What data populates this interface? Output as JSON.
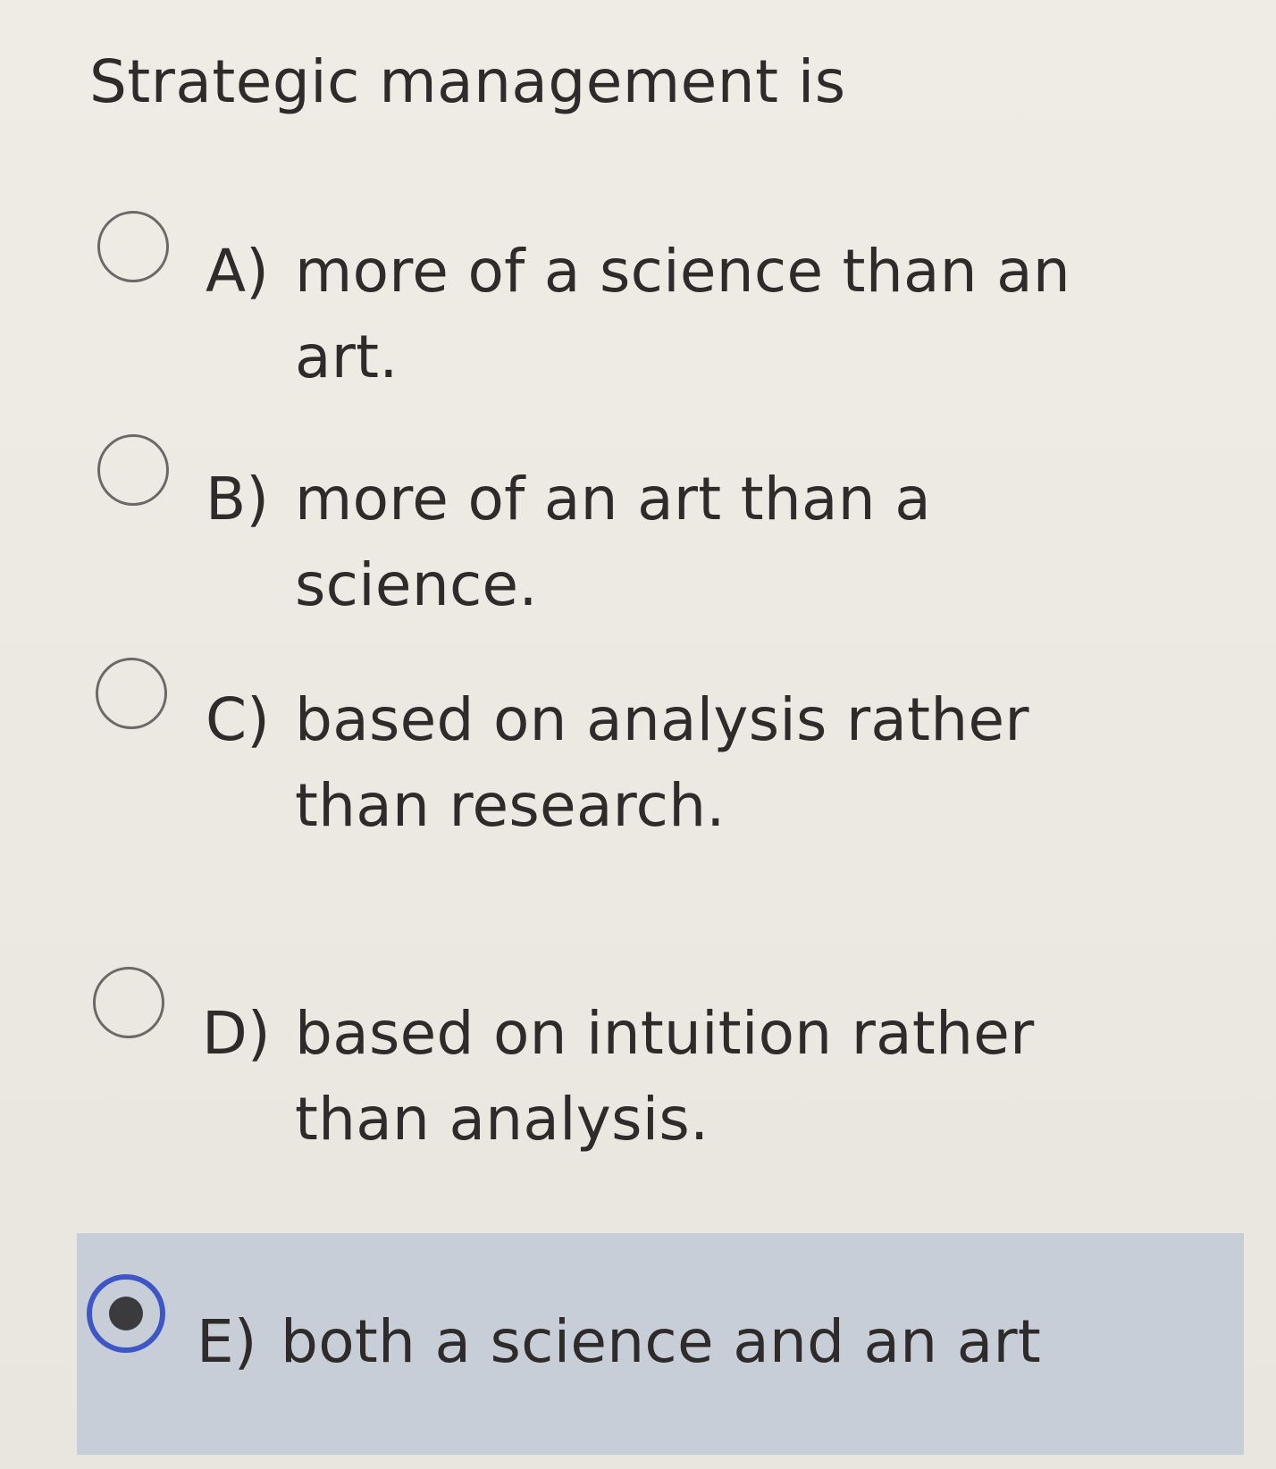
{
  "question": {
    "text": "Strategic management is"
  },
  "options": [
    {
      "letter": "A)",
      "text": "more of a science than an art.",
      "selected": false
    },
    {
      "letter": "B)",
      "text": "more of an art than a science.",
      "selected": false
    },
    {
      "letter": "C)",
      "text": "based on analysis rather than research.",
      "selected": false
    },
    {
      "letter": "D)",
      "text": "based on intuition rather than analysis.",
      "selected": false
    },
    {
      "letter": "E)",
      "text": "both a science and an art",
      "selected": true
    }
  ],
  "colors": {
    "background": "#ece8e2",
    "selected_background": "#c7ced8",
    "radio_selected_ring": "#3f56c6",
    "text": "#2f2b2b"
  }
}
